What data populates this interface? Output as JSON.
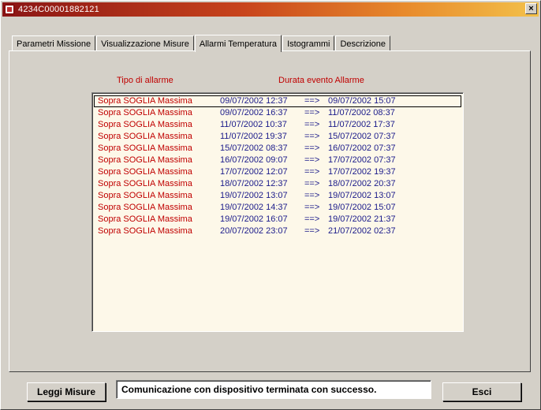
{
  "window": {
    "title": "4234C00001882121",
    "close_label": "×"
  },
  "tabs": [
    {
      "label": "Parametri Missione"
    },
    {
      "label": "Visualizzazione Misure"
    },
    {
      "label": "Allarmi Temperatura"
    },
    {
      "label": "Istogrammi"
    },
    {
      "label": "Descrizione"
    }
  ],
  "alarms": {
    "col_type": "Tipo di allarme",
    "col_duration": "Durata evento Allarme",
    "rows": [
      {
        "type": "Sopra SOGLIA Massima",
        "start": "09/07/2002 12:37",
        "arrow": "==>",
        "end": "09/07/2002 15:07"
      },
      {
        "type": "Sopra SOGLIA Massima",
        "start": "09/07/2002 16:37",
        "arrow": "==>",
        "end": "11/07/2002 08:37"
      },
      {
        "type": "Sopra SOGLIA Massima",
        "start": "11/07/2002 10:37",
        "arrow": "==>",
        "end": "11/07/2002 17:37"
      },
      {
        "type": "Sopra SOGLIA Massima",
        "start": "11/07/2002 19:37",
        "arrow": "==>",
        "end": "15/07/2002 07:37"
      },
      {
        "type": "Sopra SOGLIA Massima",
        "start": "15/07/2002 08:37",
        "arrow": "==>",
        "end": "16/07/2002 07:37"
      },
      {
        "type": "Sopra SOGLIA Massima",
        "start": "16/07/2002 09:07",
        "arrow": "==>",
        "end": "17/07/2002 07:37"
      },
      {
        "type": "Sopra SOGLIA Massima",
        "start": "17/07/2002 12:07",
        "arrow": "==>",
        "end": "17/07/2002 19:37"
      },
      {
        "type": "Sopra SOGLIA Massima",
        "start": "18/07/2002 12:37",
        "arrow": "==>",
        "end": "18/07/2002 20:37"
      },
      {
        "type": "Sopra SOGLIA Massima",
        "start": "19/07/2002 13:07",
        "arrow": "==>",
        "end": "19/07/2002 13:07"
      },
      {
        "type": "Sopra SOGLIA Massima",
        "start": "19/07/2002 14:37",
        "arrow": "==>",
        "end": "19/07/2002 15:07"
      },
      {
        "type": "Sopra SOGLIA Massima",
        "start": "19/07/2002 16:07",
        "arrow": "==>",
        "end": "19/07/2002 21:37"
      },
      {
        "type": "Sopra SOGLIA Massima",
        "start": "20/07/2002 23:07",
        "arrow": "==>",
        "end": "21/07/2002 02:37"
      }
    ]
  },
  "footer": {
    "read_button": "Leggi Misure",
    "status_text": "Comunicazione con dispositivo terminata con successo.",
    "exit_button": "Esci"
  },
  "colors": {
    "alarm_red": "#c00000",
    "date_blue": "#1a1a8a",
    "list_bg": "#fdf8e9"
  }
}
